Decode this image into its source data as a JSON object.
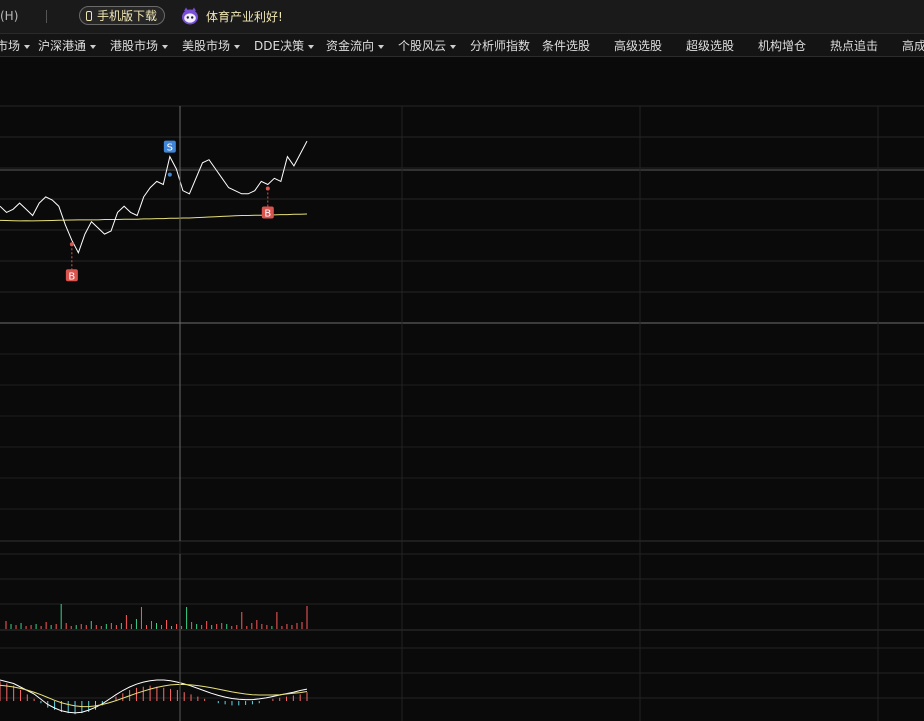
{
  "toolbar": {
    "help_menu": "(H)",
    "mobile_download": "手机版下载",
    "promo_text": "体育产业利好!"
  },
  "menu": [
    {
      "label": "市场",
      "has_dropdown": true
    },
    {
      "label": "沪深港通",
      "has_dropdown": true
    },
    {
      "label": "港股市场",
      "has_dropdown": true
    },
    {
      "label": "美股市场",
      "has_dropdown": true
    },
    {
      "label": "DDE决策",
      "has_dropdown": true
    },
    {
      "label": "资金流向",
      "has_dropdown": true
    },
    {
      "label": "个股风云",
      "has_dropdown": true
    },
    {
      "label": "分析师指数",
      "has_dropdown": false
    },
    {
      "label": "条件选股",
      "has_dropdown": false
    },
    {
      "label": "高级选股",
      "has_dropdown": false
    },
    {
      "label": "超级选股",
      "has_dropdown": false
    },
    {
      "label": "机构增仓",
      "has_dropdown": false
    },
    {
      "label": "热点追击",
      "has_dropdown": false
    },
    {
      "label": "高成",
      "has_dropdown": false
    }
  ],
  "signals": {
    "sell_label": "S",
    "buy_label": "B"
  },
  "colors": {
    "background": "#0a0a0a",
    "price_line": "#ffffff",
    "ma_line": "#e8e07a",
    "volume_up": "#ff5a5a",
    "volume_down": "#39d08a",
    "macd_up": "#ff6a6a",
    "macd_down": "#5fd6e6",
    "sell_badge": "#3f86d8",
    "buy_badge": "#d9534f",
    "accent_text": "#f0e6b4"
  },
  "chart_data": {
    "type": "line",
    "price": [
      58,
      56,
      57,
      59,
      57,
      55,
      59,
      61,
      60,
      58,
      52,
      47,
      43,
      49,
      53,
      51,
      49,
      50,
      56,
      58,
      56,
      55,
      61,
      64,
      66,
      65,
      74,
      70,
      63,
      62,
      67,
      72,
      73,
      70,
      67,
      64,
      63,
      62,
      62,
      63,
      66,
      65,
      67,
      66,
      74,
      71,
      75,
      79
    ],
    "ma": [
      54,
      53.9,
      53.8,
      53.7,
      53.7,
      53.6,
      53.6,
      53.6,
      53.6,
      53.6,
      53.6,
      53.6,
      53.6,
      53.6,
      53.6,
      53.6,
      53.7,
      53.7,
      53.7,
      53.8,
      53.8,
      53.8,
      53.9,
      53.9,
      54,
      54,
      54.1,
      54.1,
      54.2,
      54.2,
      54.3,
      54.4,
      54.5,
      54.6,
      54.7,
      54.8,
      54.9,
      55,
      55,
      55.1,
      55.1,
      55.2,
      55.2,
      55.3,
      55.3,
      55.4,
      55.4,
      55.5
    ],
    "volume": [
      8,
      -5,
      4,
      -6,
      3,
      4,
      -5,
      3,
      7,
      -4,
      5,
      -25,
      6,
      3,
      -4,
      5,
      4,
      -8,
      4,
      3,
      -5,
      6,
      4,
      -6,
      14,
      5,
      -10,
      22,
      4,
      8,
      -6,
      4,
      9,
      -3,
      5,
      3,
      -22,
      7,
      -5,
      4,
      8,
      -4,
      5,
      6,
      -5,
      3,
      4,
      17,
      3,
      6,
      9,
      5,
      4,
      -3,
      17,
      3,
      5,
      4,
      6,
      7,
      23
    ],
    "macd_diff": [
      9,
      8,
      7,
      5,
      3,
      1,
      -1,
      -3,
      -4,
      -5,
      -5.5,
      -6,
      -5.5,
      -5,
      -4,
      -2,
      0,
      2,
      3.5,
      5,
      6,
      6.5,
      7,
      6.5,
      6,
      5.5,
      5,
      4,
      3,
      2,
      1,
      0,
      -1,
      -1.5,
      -2,
      -2,
      -1.8,
      -1.5,
      -1,
      0,
      1,
      1.5,
      2,
      2.5,
      3,
      4
    ],
    "macd_dif": [
      6,
      5.5,
      5,
      4,
      3,
      2,
      0.5,
      -1,
      -2,
      -2.8,
      -3.2,
      -3.4,
      -3.2,
      -2.6,
      -1.8,
      -0.8,
      0.5,
      1.8,
      3,
      4,
      4.8,
      5.4,
      5.8,
      6,
      6,
      5.8,
      5.4,
      4.9,
      4.3,
      3.6,
      2.9,
      2.2,
      1.6,
      1.1,
      0.7,
      0.5,
      0.4,
      0.4,
      0.6,
      0.9,
      1.3,
      1.7,
      2.1,
      2.5,
      3,
      3.4
    ],
    "macd_dea": [
      4.5,
      4.3,
      4,
      3.6,
      3.1,
      2.5,
      1.8,
      1,
      0.2,
      -0.5,
      -1,
      -1.4,
      -1.6,
      -1.6,
      -1.4,
      -1,
      -0.5,
      0.1,
      0.8,
      1.5,
      2.2,
      2.8,
      3.4,
      3.9,
      4.3,
      4.6,
      4.7,
      4.7,
      4.6,
      4.4,
      4.1,
      3.8,
      3.4,
      3,
      2.6,
      2.3,
      2,
      1.8,
      1.7,
      1.7,
      1.7,
      1.8,
      2,
      2.2,
      2.4,
      2.7
    ],
    "sell_index": 26,
    "buy_indices": [
      11,
      41
    ]
  }
}
